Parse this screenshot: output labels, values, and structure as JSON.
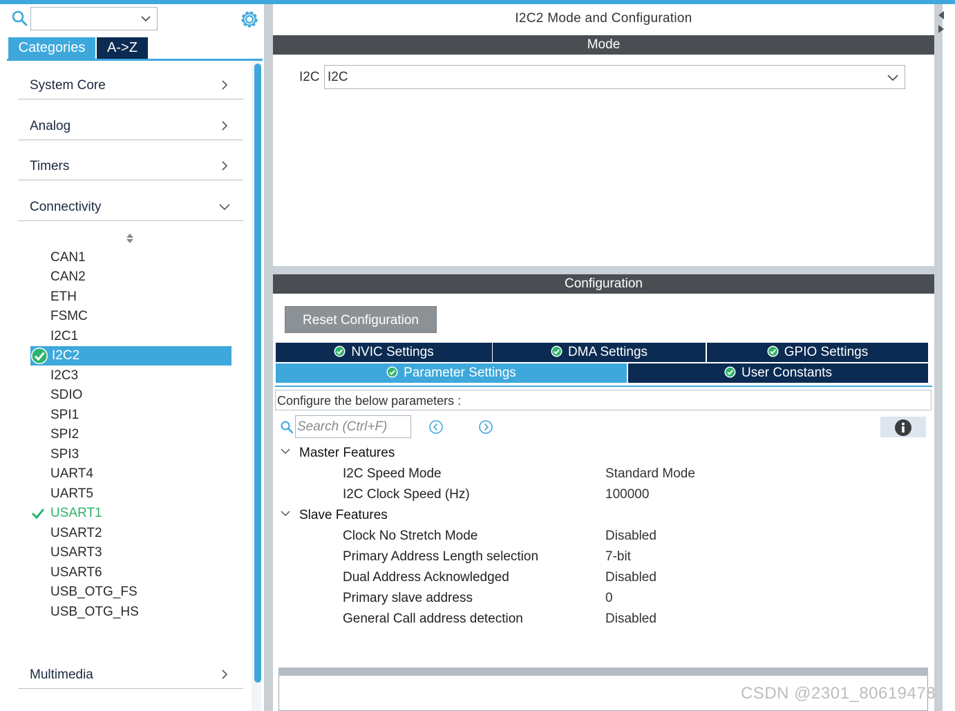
{
  "left_panel": {
    "search": {
      "value": ""
    },
    "tabs": {
      "categories": "Categories",
      "a_to_z": "A->Z"
    },
    "categories": [
      {
        "label": "System Core",
        "expanded": false
      },
      {
        "label": "Analog",
        "expanded": false
      },
      {
        "label": "Timers",
        "expanded": false
      },
      {
        "label": "Connectivity",
        "expanded": true
      },
      {
        "label": "Multimedia",
        "expanded": false
      }
    ],
    "connectivity_items": [
      {
        "label": "CAN1",
        "status": "none"
      },
      {
        "label": "CAN2",
        "status": "none"
      },
      {
        "label": "ETH",
        "status": "none"
      },
      {
        "label": "FSMC",
        "status": "none"
      },
      {
        "label": "I2C1",
        "status": "none"
      },
      {
        "label": "I2C2",
        "status": "selected-configured"
      },
      {
        "label": "I2C3",
        "status": "none"
      },
      {
        "label": "SDIO",
        "status": "none"
      },
      {
        "label": "SPI1",
        "status": "none"
      },
      {
        "label": "SPI2",
        "status": "none"
      },
      {
        "label": "SPI3",
        "status": "none"
      },
      {
        "label": "UART4",
        "status": "none"
      },
      {
        "label": "UART5",
        "status": "none"
      },
      {
        "label": "USART1",
        "status": "configured"
      },
      {
        "label": "USART2",
        "status": "none"
      },
      {
        "label": "USART3",
        "status": "none"
      },
      {
        "label": "USART6",
        "status": "none"
      },
      {
        "label": "USB_OTG_FS",
        "status": "none"
      },
      {
        "label": "USB_OTG_HS",
        "status": "none"
      }
    ]
  },
  "right_panel": {
    "title": "I2C2 Mode and Configuration",
    "mode_band": "Mode",
    "mode": {
      "label": "I2C",
      "selected": "I2C"
    },
    "configuration_band": "Configuration",
    "reset_button": "Reset Configuration",
    "tabs_row1": [
      "NVIC Settings",
      "DMA Settings",
      "GPIO Settings"
    ],
    "tabs_row2": [
      "Parameter Settings",
      "User Constants"
    ],
    "active_tab": "Parameter Settings",
    "param_hint": "Configure the below parameters :",
    "param_search_placeholder": "Search (Ctrl+F)",
    "sections": [
      {
        "title": "Master Features",
        "params": [
          {
            "name": "I2C Speed Mode",
            "value": "Standard Mode"
          },
          {
            "name": "I2C Clock Speed (Hz)",
            "value": "100000"
          }
        ]
      },
      {
        "title": "Slave Features",
        "params": [
          {
            "name": "Clock No Stretch Mode",
            "value": "Disabled"
          },
          {
            "name": "Primary Address Length selection",
            "value": "7-bit"
          },
          {
            "name": "Dual Address Acknowledged",
            "value": "Disabled"
          },
          {
            "name": "Primary slave address",
            "value": "0"
          },
          {
            "name": "General Call address detection",
            "value": "Disabled"
          }
        ]
      }
    ]
  },
  "watermark": "CSDN @2301_80619478",
  "colors": {
    "accent": "#3ea8dc",
    "navy": "#0b2b52",
    "band": "#4a4e52",
    "ok_green": "#2db36b"
  },
  "icons": [
    "search-icon",
    "gear-icon",
    "chevron-right-icon",
    "chevron-down-icon",
    "sort-icon",
    "check-circle-icon",
    "checkmark-icon",
    "info-icon",
    "nav-prev-icon",
    "nav-next-icon"
  ]
}
